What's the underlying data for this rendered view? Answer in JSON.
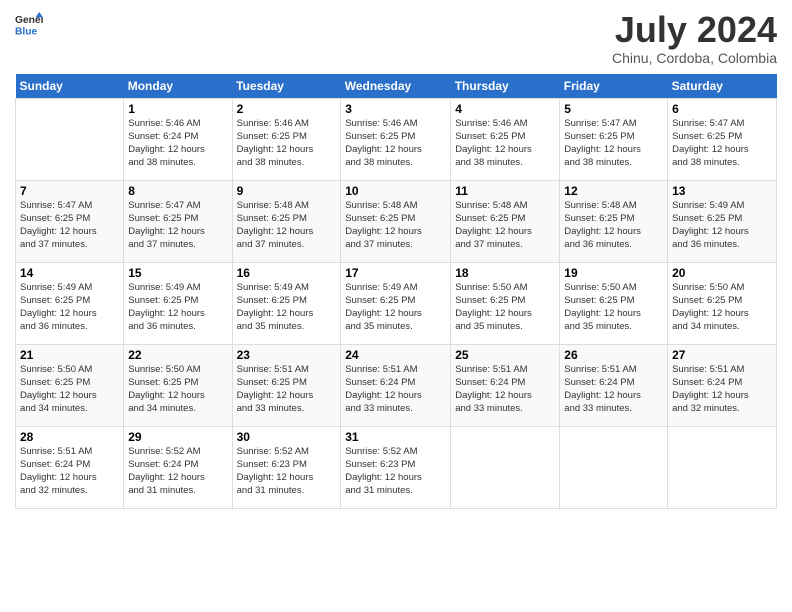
{
  "header": {
    "logo_line1": "General",
    "logo_line2": "Blue",
    "title": "July 2024",
    "subtitle": "Chinu, Cordoba, Colombia"
  },
  "weekdays": [
    "Sunday",
    "Monday",
    "Tuesday",
    "Wednesday",
    "Thursday",
    "Friday",
    "Saturday"
  ],
  "weeks": [
    [
      {
        "num": "",
        "info": ""
      },
      {
        "num": "1",
        "info": "Sunrise: 5:46 AM\nSunset: 6:24 PM\nDaylight: 12 hours\nand 38 minutes."
      },
      {
        "num": "2",
        "info": "Sunrise: 5:46 AM\nSunset: 6:25 PM\nDaylight: 12 hours\nand 38 minutes."
      },
      {
        "num": "3",
        "info": "Sunrise: 5:46 AM\nSunset: 6:25 PM\nDaylight: 12 hours\nand 38 minutes."
      },
      {
        "num": "4",
        "info": "Sunrise: 5:46 AM\nSunset: 6:25 PM\nDaylight: 12 hours\nand 38 minutes."
      },
      {
        "num": "5",
        "info": "Sunrise: 5:47 AM\nSunset: 6:25 PM\nDaylight: 12 hours\nand 38 minutes."
      },
      {
        "num": "6",
        "info": "Sunrise: 5:47 AM\nSunset: 6:25 PM\nDaylight: 12 hours\nand 38 minutes."
      }
    ],
    [
      {
        "num": "7",
        "info": "Sunrise: 5:47 AM\nSunset: 6:25 PM\nDaylight: 12 hours\nand 37 minutes."
      },
      {
        "num": "8",
        "info": "Sunrise: 5:47 AM\nSunset: 6:25 PM\nDaylight: 12 hours\nand 37 minutes."
      },
      {
        "num": "9",
        "info": "Sunrise: 5:48 AM\nSunset: 6:25 PM\nDaylight: 12 hours\nand 37 minutes."
      },
      {
        "num": "10",
        "info": "Sunrise: 5:48 AM\nSunset: 6:25 PM\nDaylight: 12 hours\nand 37 minutes."
      },
      {
        "num": "11",
        "info": "Sunrise: 5:48 AM\nSunset: 6:25 PM\nDaylight: 12 hours\nand 37 minutes."
      },
      {
        "num": "12",
        "info": "Sunrise: 5:48 AM\nSunset: 6:25 PM\nDaylight: 12 hours\nand 36 minutes."
      },
      {
        "num": "13",
        "info": "Sunrise: 5:49 AM\nSunset: 6:25 PM\nDaylight: 12 hours\nand 36 minutes."
      }
    ],
    [
      {
        "num": "14",
        "info": "Sunrise: 5:49 AM\nSunset: 6:25 PM\nDaylight: 12 hours\nand 36 minutes."
      },
      {
        "num": "15",
        "info": "Sunrise: 5:49 AM\nSunset: 6:25 PM\nDaylight: 12 hours\nand 36 minutes."
      },
      {
        "num": "16",
        "info": "Sunrise: 5:49 AM\nSunset: 6:25 PM\nDaylight: 12 hours\nand 35 minutes."
      },
      {
        "num": "17",
        "info": "Sunrise: 5:49 AM\nSunset: 6:25 PM\nDaylight: 12 hours\nand 35 minutes."
      },
      {
        "num": "18",
        "info": "Sunrise: 5:50 AM\nSunset: 6:25 PM\nDaylight: 12 hours\nand 35 minutes."
      },
      {
        "num": "19",
        "info": "Sunrise: 5:50 AM\nSunset: 6:25 PM\nDaylight: 12 hours\nand 35 minutes."
      },
      {
        "num": "20",
        "info": "Sunrise: 5:50 AM\nSunset: 6:25 PM\nDaylight: 12 hours\nand 34 minutes."
      }
    ],
    [
      {
        "num": "21",
        "info": "Sunrise: 5:50 AM\nSunset: 6:25 PM\nDaylight: 12 hours\nand 34 minutes."
      },
      {
        "num": "22",
        "info": "Sunrise: 5:50 AM\nSunset: 6:25 PM\nDaylight: 12 hours\nand 34 minutes."
      },
      {
        "num": "23",
        "info": "Sunrise: 5:51 AM\nSunset: 6:25 PM\nDaylight: 12 hours\nand 33 minutes."
      },
      {
        "num": "24",
        "info": "Sunrise: 5:51 AM\nSunset: 6:24 PM\nDaylight: 12 hours\nand 33 minutes."
      },
      {
        "num": "25",
        "info": "Sunrise: 5:51 AM\nSunset: 6:24 PM\nDaylight: 12 hours\nand 33 minutes."
      },
      {
        "num": "26",
        "info": "Sunrise: 5:51 AM\nSunset: 6:24 PM\nDaylight: 12 hours\nand 33 minutes."
      },
      {
        "num": "27",
        "info": "Sunrise: 5:51 AM\nSunset: 6:24 PM\nDaylight: 12 hours\nand 32 minutes."
      }
    ],
    [
      {
        "num": "28",
        "info": "Sunrise: 5:51 AM\nSunset: 6:24 PM\nDaylight: 12 hours\nand 32 minutes."
      },
      {
        "num": "29",
        "info": "Sunrise: 5:52 AM\nSunset: 6:24 PM\nDaylight: 12 hours\nand 31 minutes."
      },
      {
        "num": "30",
        "info": "Sunrise: 5:52 AM\nSunset: 6:23 PM\nDaylight: 12 hours\nand 31 minutes."
      },
      {
        "num": "31",
        "info": "Sunrise: 5:52 AM\nSunset: 6:23 PM\nDaylight: 12 hours\nand 31 minutes."
      },
      {
        "num": "",
        "info": ""
      },
      {
        "num": "",
        "info": ""
      },
      {
        "num": "",
        "info": ""
      }
    ]
  ]
}
